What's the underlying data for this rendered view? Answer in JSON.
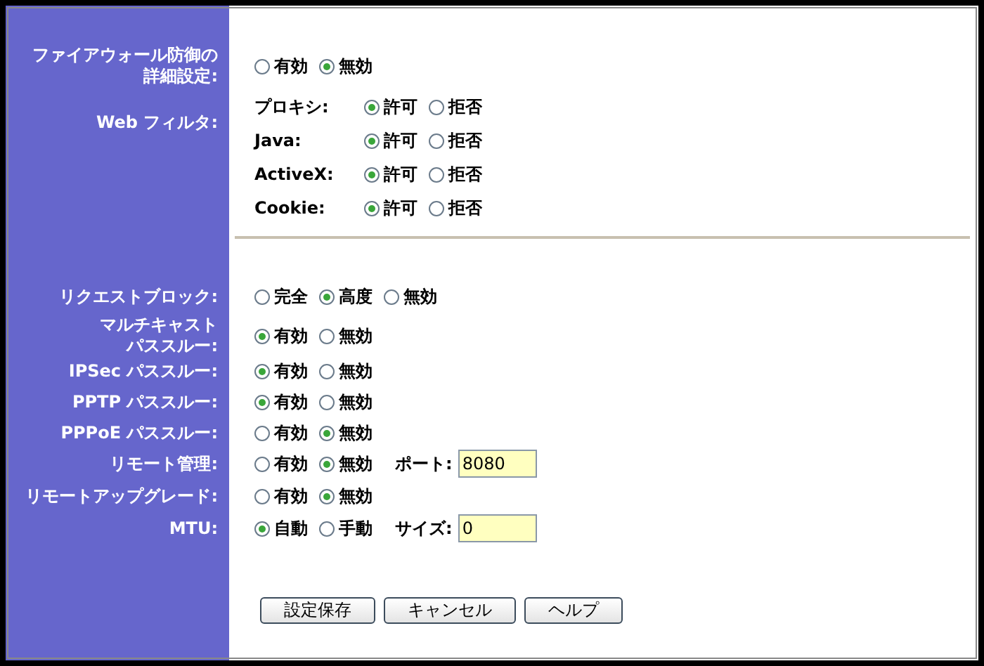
{
  "firewall": {
    "label": "ファイアウォール防御の詳細設定:",
    "options": [
      {
        "label": "有効",
        "selected": false
      },
      {
        "label": "無効",
        "selected": true
      }
    ]
  },
  "web_filter": {
    "label": "Web フィルタ:",
    "items": [
      {
        "label": "プロキシ:",
        "options": [
          {
            "label": "許可",
            "selected": true
          },
          {
            "label": "拒否",
            "selected": false
          }
        ]
      },
      {
        "label": "Java:",
        "options": [
          {
            "label": "許可",
            "selected": true
          },
          {
            "label": "拒否",
            "selected": false
          }
        ]
      },
      {
        "label": "ActiveX:",
        "options": [
          {
            "label": "許可",
            "selected": true
          },
          {
            "label": "拒否",
            "selected": false
          }
        ]
      },
      {
        "label": "Cookie:",
        "options": [
          {
            "label": "許可",
            "selected": true
          },
          {
            "label": "拒否",
            "selected": false
          }
        ]
      }
    ]
  },
  "settings": [
    {
      "label": "リクエストブロック:",
      "options": [
        {
          "label": "完全",
          "selected": false
        },
        {
          "label": "高度",
          "selected": true
        },
        {
          "label": "無効",
          "selected": false
        }
      ]
    },
    {
      "label": "マルチキャストパススルー:",
      "options": [
        {
          "label": "有効",
          "selected": true
        },
        {
          "label": "無効",
          "selected": false
        }
      ]
    },
    {
      "label": "IPSec パススルー:",
      "options": [
        {
          "label": "有効",
          "selected": true
        },
        {
          "label": "無効",
          "selected": false
        }
      ]
    },
    {
      "label": "PPTP パススルー:",
      "options": [
        {
          "label": "有効",
          "selected": true
        },
        {
          "label": "無効",
          "selected": false
        }
      ]
    },
    {
      "label": "PPPoE パススルー:",
      "options": [
        {
          "label": "有効",
          "selected": false
        },
        {
          "label": "無効",
          "selected": true
        }
      ]
    },
    {
      "label": "リモート管理:",
      "options": [
        {
          "label": "有効",
          "selected": false
        },
        {
          "label": "無効",
          "selected": true
        }
      ],
      "field": {
        "label": "ポート:",
        "value": "8080"
      }
    },
    {
      "label": "リモートアップグレード:",
      "options": [
        {
          "label": "有効",
          "selected": false
        },
        {
          "label": "無効",
          "selected": true
        }
      ]
    },
    {
      "label": "MTU:",
      "options": [
        {
          "label": "自動",
          "selected": true
        },
        {
          "label": "手動",
          "selected": false
        }
      ],
      "field": {
        "label": "サイズ:",
        "value": "0"
      }
    }
  ],
  "buttons": [
    "設定保存",
    "キャンセル",
    "ヘルプ"
  ]
}
